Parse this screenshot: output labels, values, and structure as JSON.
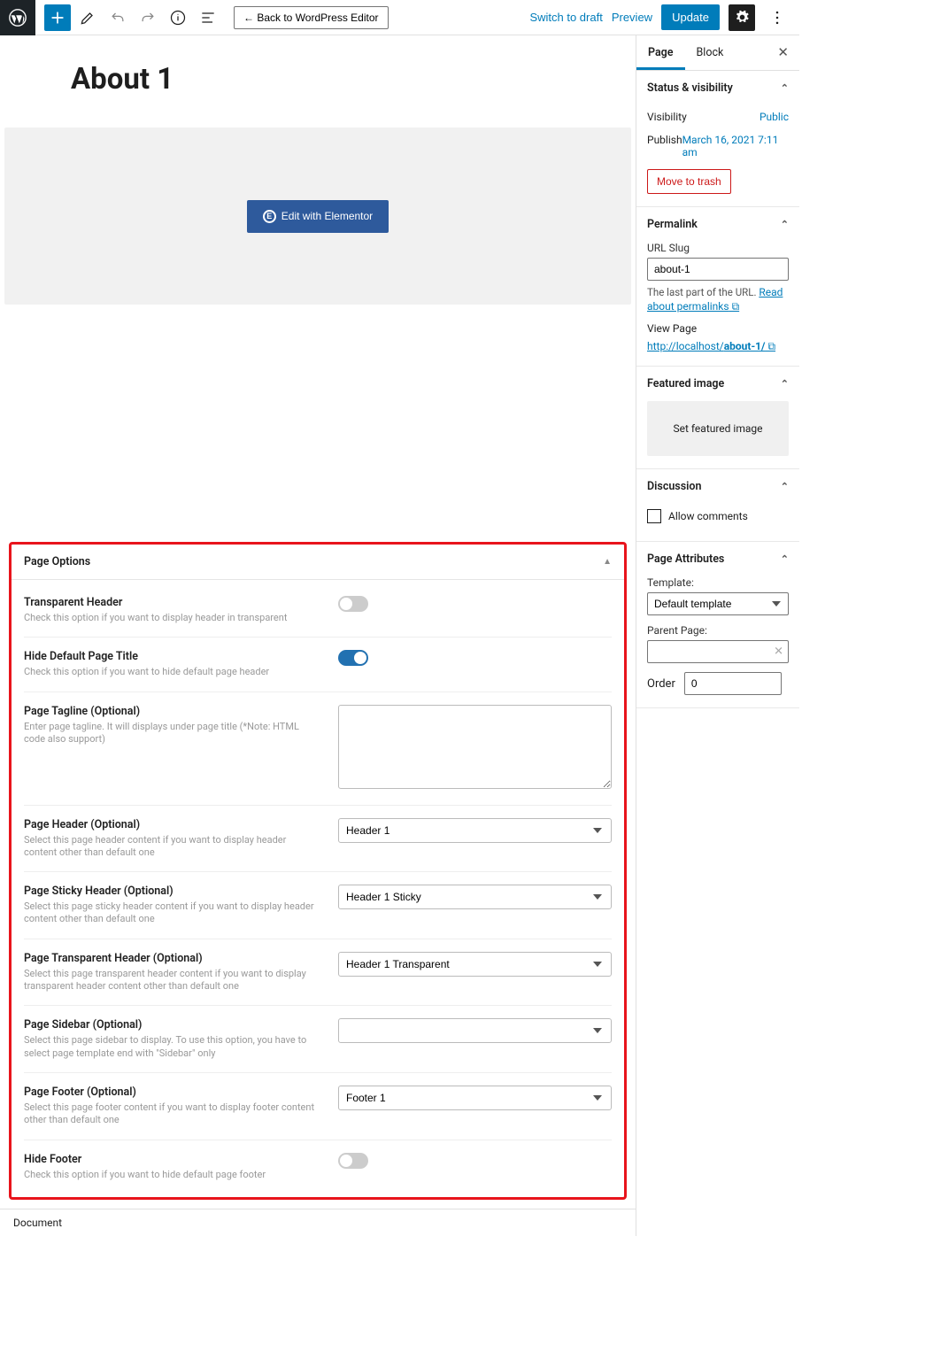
{
  "topbar": {
    "back_label": "← Back to WordPress Editor",
    "switch_draft": "Switch to draft",
    "preview": "Preview",
    "update": "Update"
  },
  "editor": {
    "page_title": "About 1",
    "elementor_btn": "Edit with Elementor"
  },
  "page_options": {
    "header": "Page Options",
    "rows": {
      "transparent_header": {
        "title": "Transparent Header",
        "desc": "Check this option if you want to display header in transparent"
      },
      "hide_title": {
        "title": "Hide Default Page Title",
        "desc": "Check this option if you want to hide default page header"
      },
      "tagline": {
        "title": "Page Tagline (Optional)",
        "desc": "Enter page tagline. It will displays under page title (*Note: HTML code also support)"
      },
      "page_header": {
        "title": "Page Header (Optional)",
        "desc": "Select this page header content if you want to display header content other than default one",
        "value": "Header 1"
      },
      "sticky_header": {
        "title": "Page Sticky Header (Optional)",
        "desc": "Select this page sticky header content if you want to display header content other than default one",
        "value": "Header 1 Sticky"
      },
      "transparent_hdr": {
        "title": "Page Transparent Header (Optional)",
        "desc": "Select this page transparent header content if you want to display transparent header content other than default one",
        "value": "Header 1 Transparent"
      },
      "sidebar": {
        "title": "Page Sidebar (Optional)",
        "desc": "Select this page sidebar to display. To use this option, you have to select page template end with \"Sidebar\" only",
        "value": ""
      },
      "footer": {
        "title": "Page Footer (Optional)",
        "desc": "Select this page footer content if you want to display footer content other than default one",
        "value": "Footer 1"
      },
      "hide_footer": {
        "title": "Hide Footer",
        "desc": "Check this option if you want to hide default page footer"
      }
    }
  },
  "footer_bar": "Document",
  "sidebar": {
    "tabs": {
      "page": "Page",
      "block": "Block"
    },
    "status": {
      "header": "Status & visibility",
      "visibility_label": "Visibility",
      "visibility_value": "Public",
      "publish_label": "Publish",
      "publish_value": "March 16, 2021 7:11 am",
      "trash": "Move to trash"
    },
    "permalink": {
      "header": "Permalink",
      "slug_label": "URL Slug",
      "slug_value": "about-1",
      "help1": "The last part of the URL. ",
      "help_link": "Read about permalinks",
      "view_label": "View Page",
      "url_prefix": "http://localhost/",
      "url_bold": "about-1/"
    },
    "featured": {
      "header": "Featured image",
      "button": "Set featured image"
    },
    "discussion": {
      "header": "Discussion",
      "allow": "Allow comments"
    },
    "attributes": {
      "header": "Page Attributes",
      "template_label": "Template:",
      "template_value": "Default template",
      "parent_label": "Parent Page:",
      "order_label": "Order",
      "order_value": "0"
    }
  }
}
